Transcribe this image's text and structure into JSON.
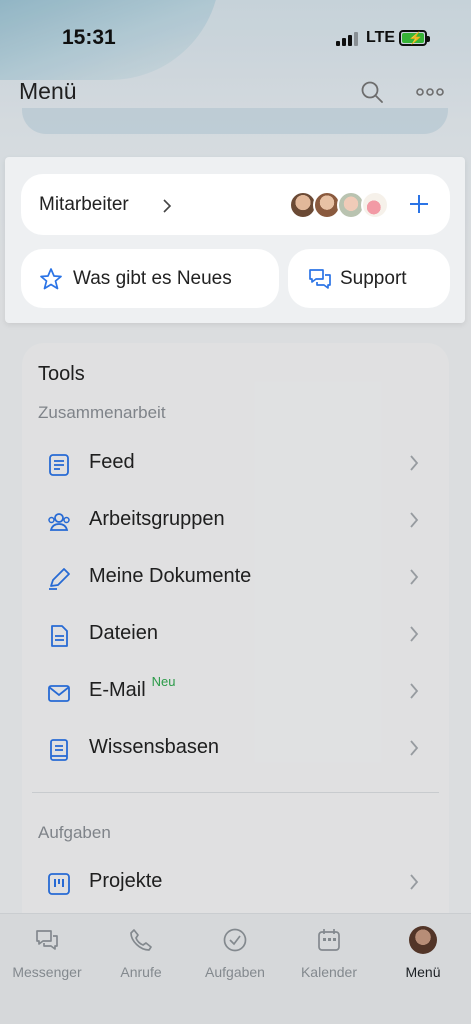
{
  "status_bar": {
    "time": "15:31",
    "network": "LTE"
  },
  "header": {
    "title": "Menü"
  },
  "popup": {
    "staff_label": "Mitarbeiter",
    "news_label": "Was gibt es Neues",
    "support_label": "Support"
  },
  "tools": {
    "title": "Tools",
    "sections": [
      {
        "label": "Zusammenarbeit",
        "items": [
          {
            "label": "Feed",
            "icon": "feed-icon"
          },
          {
            "label": "Arbeitsgruppen",
            "icon": "workgroups-icon"
          },
          {
            "label": "Meine Dokumente",
            "icon": "pen-icon"
          },
          {
            "label": "Dateien",
            "icon": "file-icon"
          },
          {
            "label": "E-Mail",
            "icon": "mail-icon",
            "badge": "Neu"
          },
          {
            "label": "Wissensbasen",
            "icon": "book-icon"
          }
        ]
      },
      {
        "label": "Aufgaben",
        "items": [
          {
            "label": "Projekte",
            "icon": "projects-icon"
          }
        ]
      }
    ]
  },
  "tab_bar": {
    "items": [
      {
        "label": "Messenger",
        "icon": "chat-icon"
      },
      {
        "label": "Anrufe",
        "icon": "phone-icon"
      },
      {
        "label": "Aufgaben",
        "icon": "check-circle-icon"
      },
      {
        "label": "Kalender",
        "icon": "calendar-icon"
      },
      {
        "label": "Menü",
        "icon": "avatar",
        "active": true
      }
    ]
  },
  "colors": {
    "accent": "#2b74e6",
    "badge_green": "#2fa84f",
    "text": "#1f2328",
    "muted": "#8a8f95"
  }
}
